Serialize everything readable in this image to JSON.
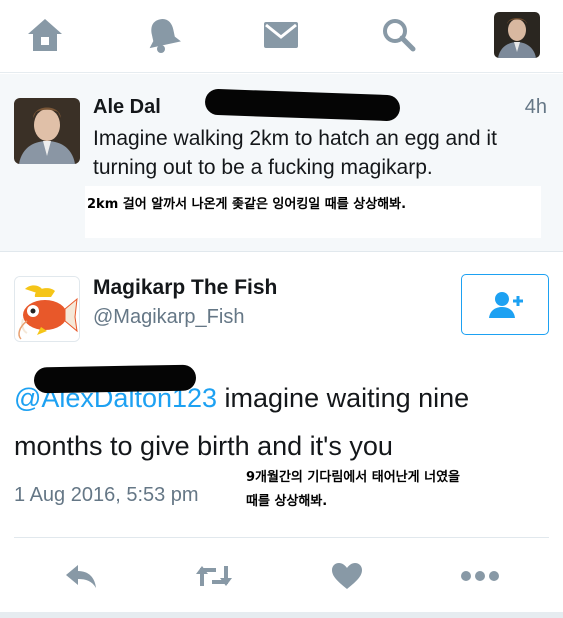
{
  "nav": {
    "items": [
      {
        "icon": "home-icon"
      },
      {
        "icon": "bell-icon"
      },
      {
        "icon": "mail-icon"
      },
      {
        "icon": "search-icon"
      },
      {
        "icon": "profile-avatar"
      }
    ],
    "icon_color": "#8899a6"
  },
  "reply_tweet": {
    "name_visible": "Ale  Dal",
    "time": "4h",
    "text": "Imagine walking 2km to hatch an egg and it turning out to be a fucking magikarp.",
    "translation": "2km 걸어 알까서 나온게 좆같은 잉어킹일 때를 상상해봐."
  },
  "tweet": {
    "display_name": "Magikarp The Fish",
    "handle": "@Magikarp_Fish",
    "mention_visible": "@AlexDalton123",
    "text": " imagine waiting nine months to give birth and it's you",
    "timestamp": "1 Aug 2016, 5:53 pm",
    "translation_line1": "9개월간의 기다림에서 태어난게 너였을",
    "translation_line2": "때를 상상해봐."
  },
  "actions": [
    "reply-icon",
    "retweet-icon",
    "like-icon",
    "more-icon"
  ],
  "colors": {
    "accent": "#1da1f2",
    "muted": "#657786",
    "icon_muted": "#8899a6",
    "highlight_bg": "#f5f8fa"
  }
}
